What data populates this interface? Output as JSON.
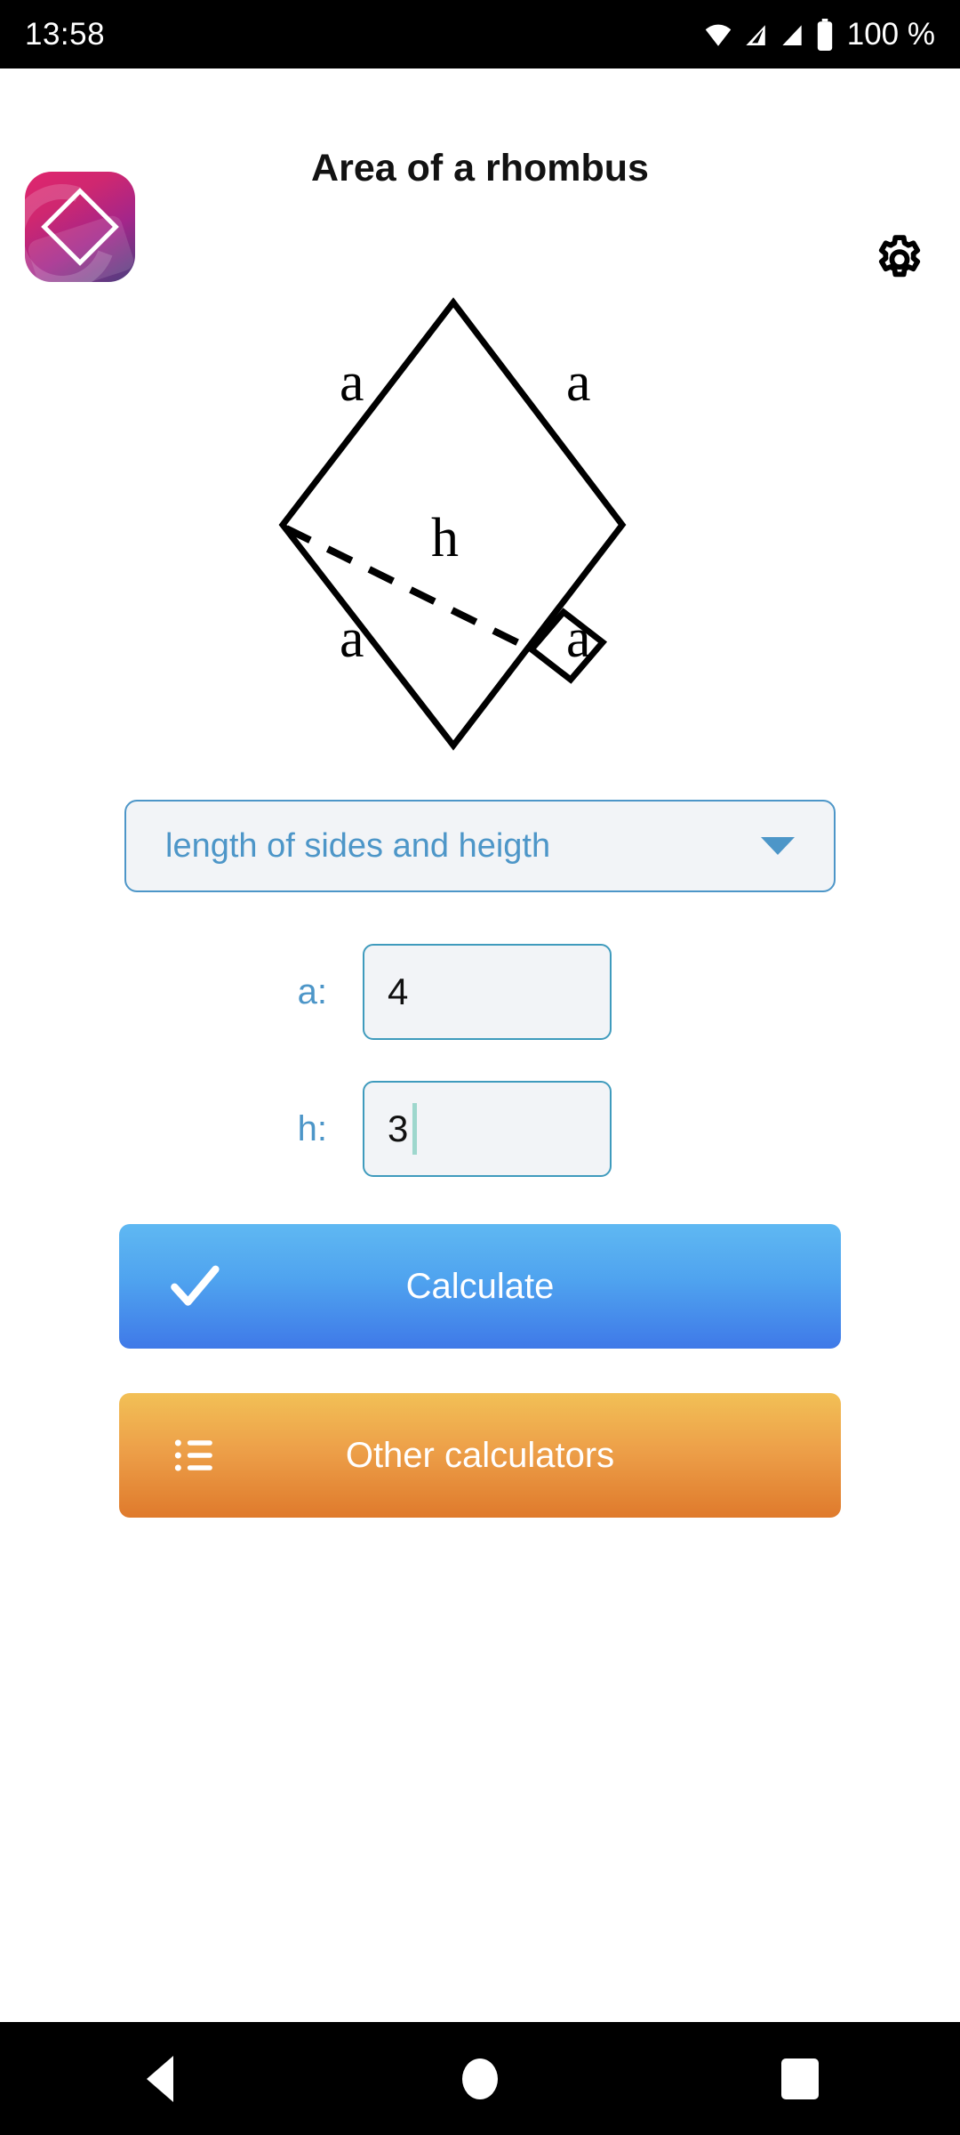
{
  "status_bar": {
    "time": "13:58",
    "battery_text": "100 %",
    "icons": [
      "wifi-icon",
      "signal-icon",
      "signal-icon",
      "battery-icon"
    ]
  },
  "header": {
    "title": "Area of a rhombus",
    "app_icon_name": "rhombus-app-icon",
    "settings_icon_name": "gear-icon"
  },
  "diagram": {
    "name": "rhombus-diagram",
    "side_labels": [
      "a",
      "a",
      "a",
      "a"
    ],
    "height_label": "h",
    "has_right_angle_marker": true,
    "has_dashed_height_line": true
  },
  "form": {
    "mode_select": {
      "selected": "length of sides and heigth",
      "caret_icon": "chevron-down-icon"
    },
    "fields": [
      {
        "label": "a:",
        "value": "4",
        "has_caret": false
      },
      {
        "label": "h:",
        "value": "3",
        "has_caret": true
      }
    ]
  },
  "actions": {
    "calculate": {
      "label": "Calculate",
      "icon": "check-icon",
      "color_top": "#5fb8f2",
      "color_bottom": "#3f79e8"
    },
    "other_calculators": {
      "label": "Other calculators",
      "icon": "list-icon",
      "color_top": "#f2c056",
      "color_bottom": "#df7a2c"
    }
  },
  "nav_bar": {
    "back": "back-icon",
    "home": "home-icon",
    "recents": "recents-icon"
  },
  "colors": {
    "accent_blue": "#4d96c8",
    "field_border": "#3f9bbd",
    "field_bg": "#f2f4f7",
    "caret": "#9ed7cd"
  }
}
